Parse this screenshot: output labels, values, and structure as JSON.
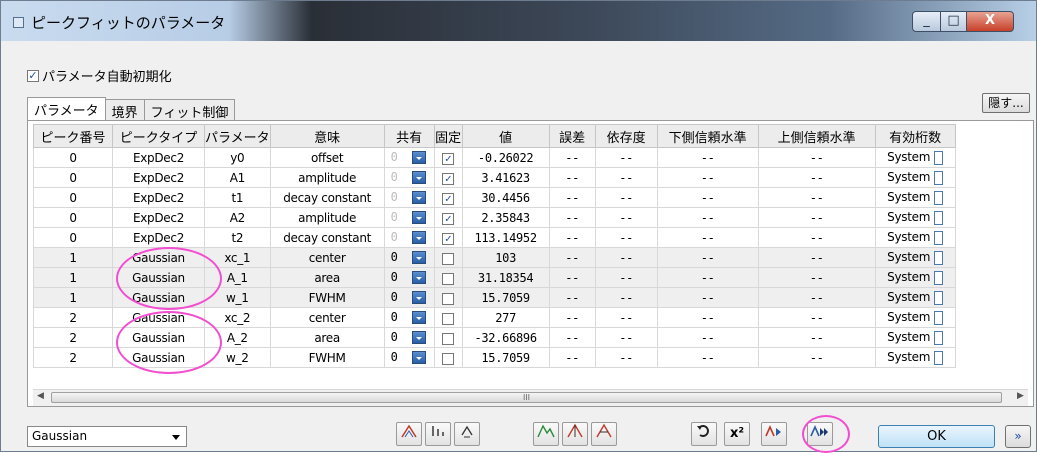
{
  "window": {
    "title": "ピークフィットのパラメータ"
  },
  "auto_init": {
    "label": "パラメータ自動初期化",
    "checked": true
  },
  "tabs": [
    "パラメータ",
    "境界",
    "フィット制御"
  ],
  "hide_button": "隠す...",
  "columns": [
    "ピーク番号",
    "ピークタイプ",
    "パラメータ",
    "意味",
    "共有",
    "固定",
    "値",
    "誤差",
    "依存度",
    "下側信頼水準",
    "上側信頼水準",
    "有効桁数"
  ],
  "rows": [
    {
      "peak": "0",
      "type": "ExpDec2",
      "param": "y0",
      "meaning": "offset",
      "share": "0",
      "fixed": true,
      "value": "-0.26022",
      "error": "--",
      "dep": "--",
      "lcl": "--",
      "ucl": "--",
      "sig": "System"
    },
    {
      "peak": "0",
      "type": "ExpDec2",
      "param": "A1",
      "meaning": "amplitude",
      "share": "0",
      "fixed": true,
      "value": "3.41623",
      "error": "--",
      "dep": "--",
      "lcl": "--",
      "ucl": "--",
      "sig": "System"
    },
    {
      "peak": "0",
      "type": "ExpDec2",
      "param": "t1",
      "meaning": "decay constant",
      "share": "0",
      "fixed": true,
      "value": "30.4456",
      "error": "--",
      "dep": "--",
      "lcl": "--",
      "ucl": "--",
      "sig": "System"
    },
    {
      "peak": "0",
      "type": "ExpDec2",
      "param": "A2",
      "meaning": "amplitude",
      "share": "0",
      "fixed": true,
      "value": "2.35843",
      "error": "--",
      "dep": "--",
      "lcl": "--",
      "ucl": "--",
      "sig": "System"
    },
    {
      "peak": "0",
      "type": "ExpDec2",
      "param": "t2",
      "meaning": "decay constant",
      "share": "0",
      "fixed": true,
      "value": "113.14952",
      "error": "--",
      "dep": "--",
      "lcl": "--",
      "ucl": "--",
      "sig": "System"
    },
    {
      "peak": "1",
      "type": "Gaussian",
      "param": "xc_1",
      "meaning": "center",
      "share": "0",
      "fixed": false,
      "value": "103",
      "error": "--",
      "dep": "--",
      "lcl": "--",
      "ucl": "--",
      "sig": "System"
    },
    {
      "peak": "1",
      "type": "Gaussian",
      "param": "A_1",
      "meaning": "area",
      "share": "0",
      "fixed": false,
      "value": "31.18354",
      "error": "--",
      "dep": "--",
      "lcl": "--",
      "ucl": "--",
      "sig": "System"
    },
    {
      "peak": "1",
      "type": "Gaussian",
      "param": "w_1",
      "meaning": "FWHM",
      "share": "0",
      "fixed": false,
      "value": "15.7059",
      "error": "--",
      "dep": "--",
      "lcl": "--",
      "ucl": "--",
      "sig": "System"
    },
    {
      "peak": "2",
      "type": "Gaussian",
      "param": "xc_2",
      "meaning": "center",
      "share": "0",
      "fixed": false,
      "value": "277",
      "error": "--",
      "dep": "--",
      "lcl": "--",
      "ucl": "--",
      "sig": "System"
    },
    {
      "peak": "2",
      "type": "Gaussian",
      "param": "A_2",
      "meaning": "area",
      "share": "0",
      "fixed": false,
      "value": "-32.66896",
      "error": "--",
      "dep": "--",
      "lcl": "--",
      "ucl": "--",
      "sig": "System"
    },
    {
      "peak": "2",
      "type": "Gaussian",
      "param": "w_2",
      "meaning": "FWHM",
      "share": "0",
      "fixed": false,
      "value": "15.7059",
      "error": "--",
      "dep": "--",
      "lcl": "--",
      "ucl": "--",
      "sig": "System"
    }
  ],
  "scrollbar_grip": "III",
  "peak_function": "Gaussian",
  "toolbar_icons": [
    "add-peak-icon",
    "sort-icon",
    "reorder-icon",
    "peak-find-icon",
    "peak-center-icon",
    "peak-width-icon",
    "undo-icon",
    "chi-square-icon",
    "fit-one-iteration-icon",
    "fit-until-converge-icon"
  ],
  "chi_label": "x²",
  "ok_button": "OK",
  "more_button": "»",
  "colors": {
    "annotation": "#f24fd0",
    "accent": "#3c7fb1"
  }
}
